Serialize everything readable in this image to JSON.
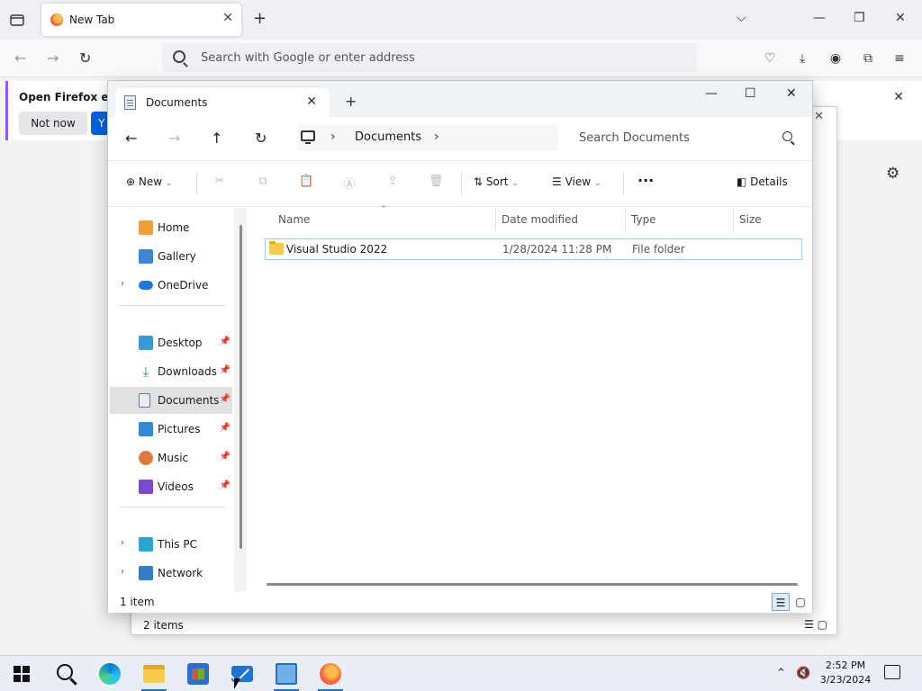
{
  "firefox": {
    "tab_title": "New Tab",
    "url_placeholder": "Search with Google or enter address",
    "notification": {
      "message": "Open Firefox eve",
      "not_now": "Not now",
      "yes": "Y"
    }
  },
  "explorer_back": {
    "status": "2 items"
  },
  "explorer": {
    "tab_title": "Documents",
    "breadcrumb": "Documents",
    "search_placeholder": "Search Documents",
    "toolbar": {
      "new": "New",
      "sort": "Sort",
      "view": "View",
      "more": "···",
      "details": "Details"
    },
    "nav": [
      {
        "label": "Home",
        "icon": "home-icon",
        "pinned": false,
        "expandable": false
      },
      {
        "label": "Gallery",
        "icon": "gallery-icon",
        "pinned": false,
        "expandable": false
      },
      {
        "label": "OneDrive",
        "icon": "onedrive-icon",
        "pinned": false,
        "expandable": true
      },
      {
        "label": "Desktop",
        "icon": "desktop-icon",
        "pinned": true,
        "expandable": false
      },
      {
        "label": "Downloads",
        "icon": "downloads-icon",
        "pinned": true,
        "expandable": false
      },
      {
        "label": "Documents",
        "icon": "documents-icon",
        "pinned": true,
        "expandable": false,
        "selected": true
      },
      {
        "label": "Pictures",
        "icon": "pictures-icon",
        "pinned": true,
        "expandable": false
      },
      {
        "label": "Music",
        "icon": "music-icon",
        "pinned": true,
        "expandable": false
      },
      {
        "label": "Videos",
        "icon": "videos-icon",
        "pinned": true,
        "expandable": false
      },
      {
        "label": "This PC",
        "icon": "this-pc-icon",
        "pinned": false,
        "expandable": true
      },
      {
        "label": "Network",
        "icon": "network-icon",
        "pinned": false,
        "expandable": true
      }
    ],
    "columns": [
      "Name",
      "Date modified",
      "Type",
      "Size"
    ],
    "rows": [
      {
        "name": "Visual Studio 2022",
        "date_modified": "1/28/2024 11:28 PM",
        "type": "File folder",
        "size": ""
      }
    ],
    "status": "1 item"
  },
  "taskbar": {
    "time": "2:52 PM",
    "date": "3/23/2024"
  }
}
